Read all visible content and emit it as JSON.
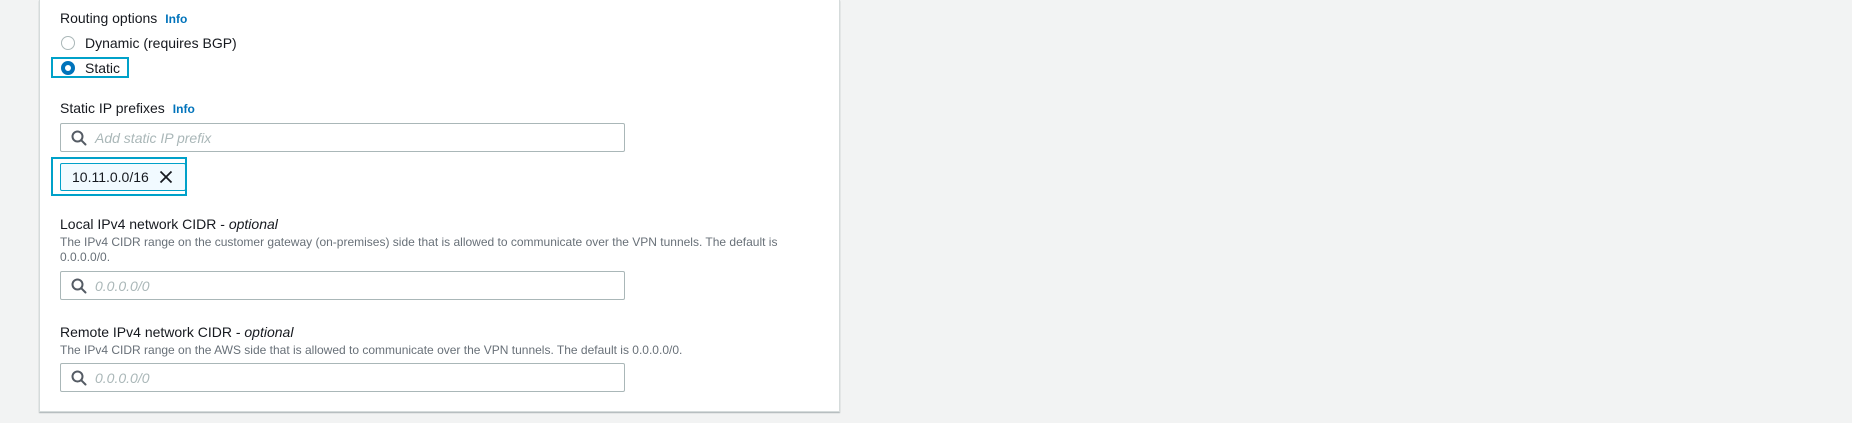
{
  "routing": {
    "label": "Routing options",
    "info": "Info",
    "options": [
      {
        "label": "Dynamic (requires BGP)",
        "checked": false
      },
      {
        "label": "Static",
        "checked": true
      }
    ]
  },
  "static_prefixes": {
    "label": "Static IP prefixes",
    "info": "Info",
    "placeholder": "Add static IP prefix",
    "tokens": [
      "10.11.0.0/16"
    ]
  },
  "local_cidr": {
    "label": "Local IPv4 network CIDR - ",
    "optional": "optional",
    "description": "The IPv4 CIDR range on the customer gateway (on-premises) side that is allowed to communicate over the VPN tunnels. The default is 0.0.0.0/0.",
    "placeholder": "0.0.0.0/0"
  },
  "remote_cidr": {
    "label": "Remote IPv4 network CIDR - ",
    "optional": "optional",
    "description": "The IPv4 CIDR range on the AWS side that is allowed to communicate over the VPN tunnels. The default is 0.0.0.0/0.",
    "placeholder": "0.0.0.0/0"
  },
  "colors": {
    "accent": "#0073bb",
    "focus": "#00a1c9",
    "background": "#f2f3f3"
  }
}
